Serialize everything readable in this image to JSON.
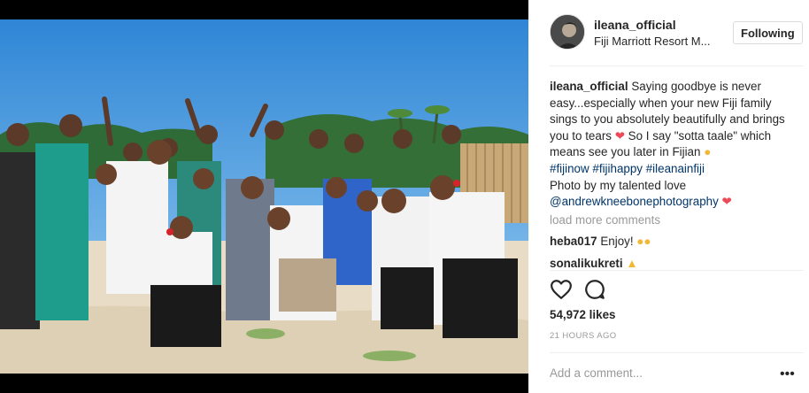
{
  "post": {
    "username": "ileana_official",
    "location": "Fiji Marriott Resort M..."
  },
  "header": {
    "follow_label": "Following"
  },
  "caption": {
    "username": "ileana_official",
    "text1": "Saying goodbye is never easy...especially when your new Fiji family sings to you absolutely beautifully and brings you to tears",
    "text2": "So I say \"sotta taale\" which means see you later in Fijian",
    "hashtags": [
      "#fijinow",
      "#fijihappy",
      "#ileanainfiji"
    ],
    "text3": "Photo by my talented love",
    "mention": "@andrewkneebonephotography"
  },
  "comments": {
    "load_more": "load more comments",
    "items": [
      {
        "user": "heba017",
        "text": "Enjoy!"
      },
      {
        "user": "sonalikukreti",
        "text": ""
      }
    ]
  },
  "actions": {
    "like_icon": "heart-outline-icon",
    "comment_icon": "comment-bubble-icon"
  },
  "stats": {
    "likes": "54,972 likes",
    "time_ago": "21 HOURS AGO"
  },
  "composer": {
    "placeholder": "Add a comment...",
    "more_glyph": "•••"
  },
  "colors": {
    "link": "#003569",
    "muted": "#999999",
    "heart": "#ed4956",
    "divider": "#efefef"
  }
}
